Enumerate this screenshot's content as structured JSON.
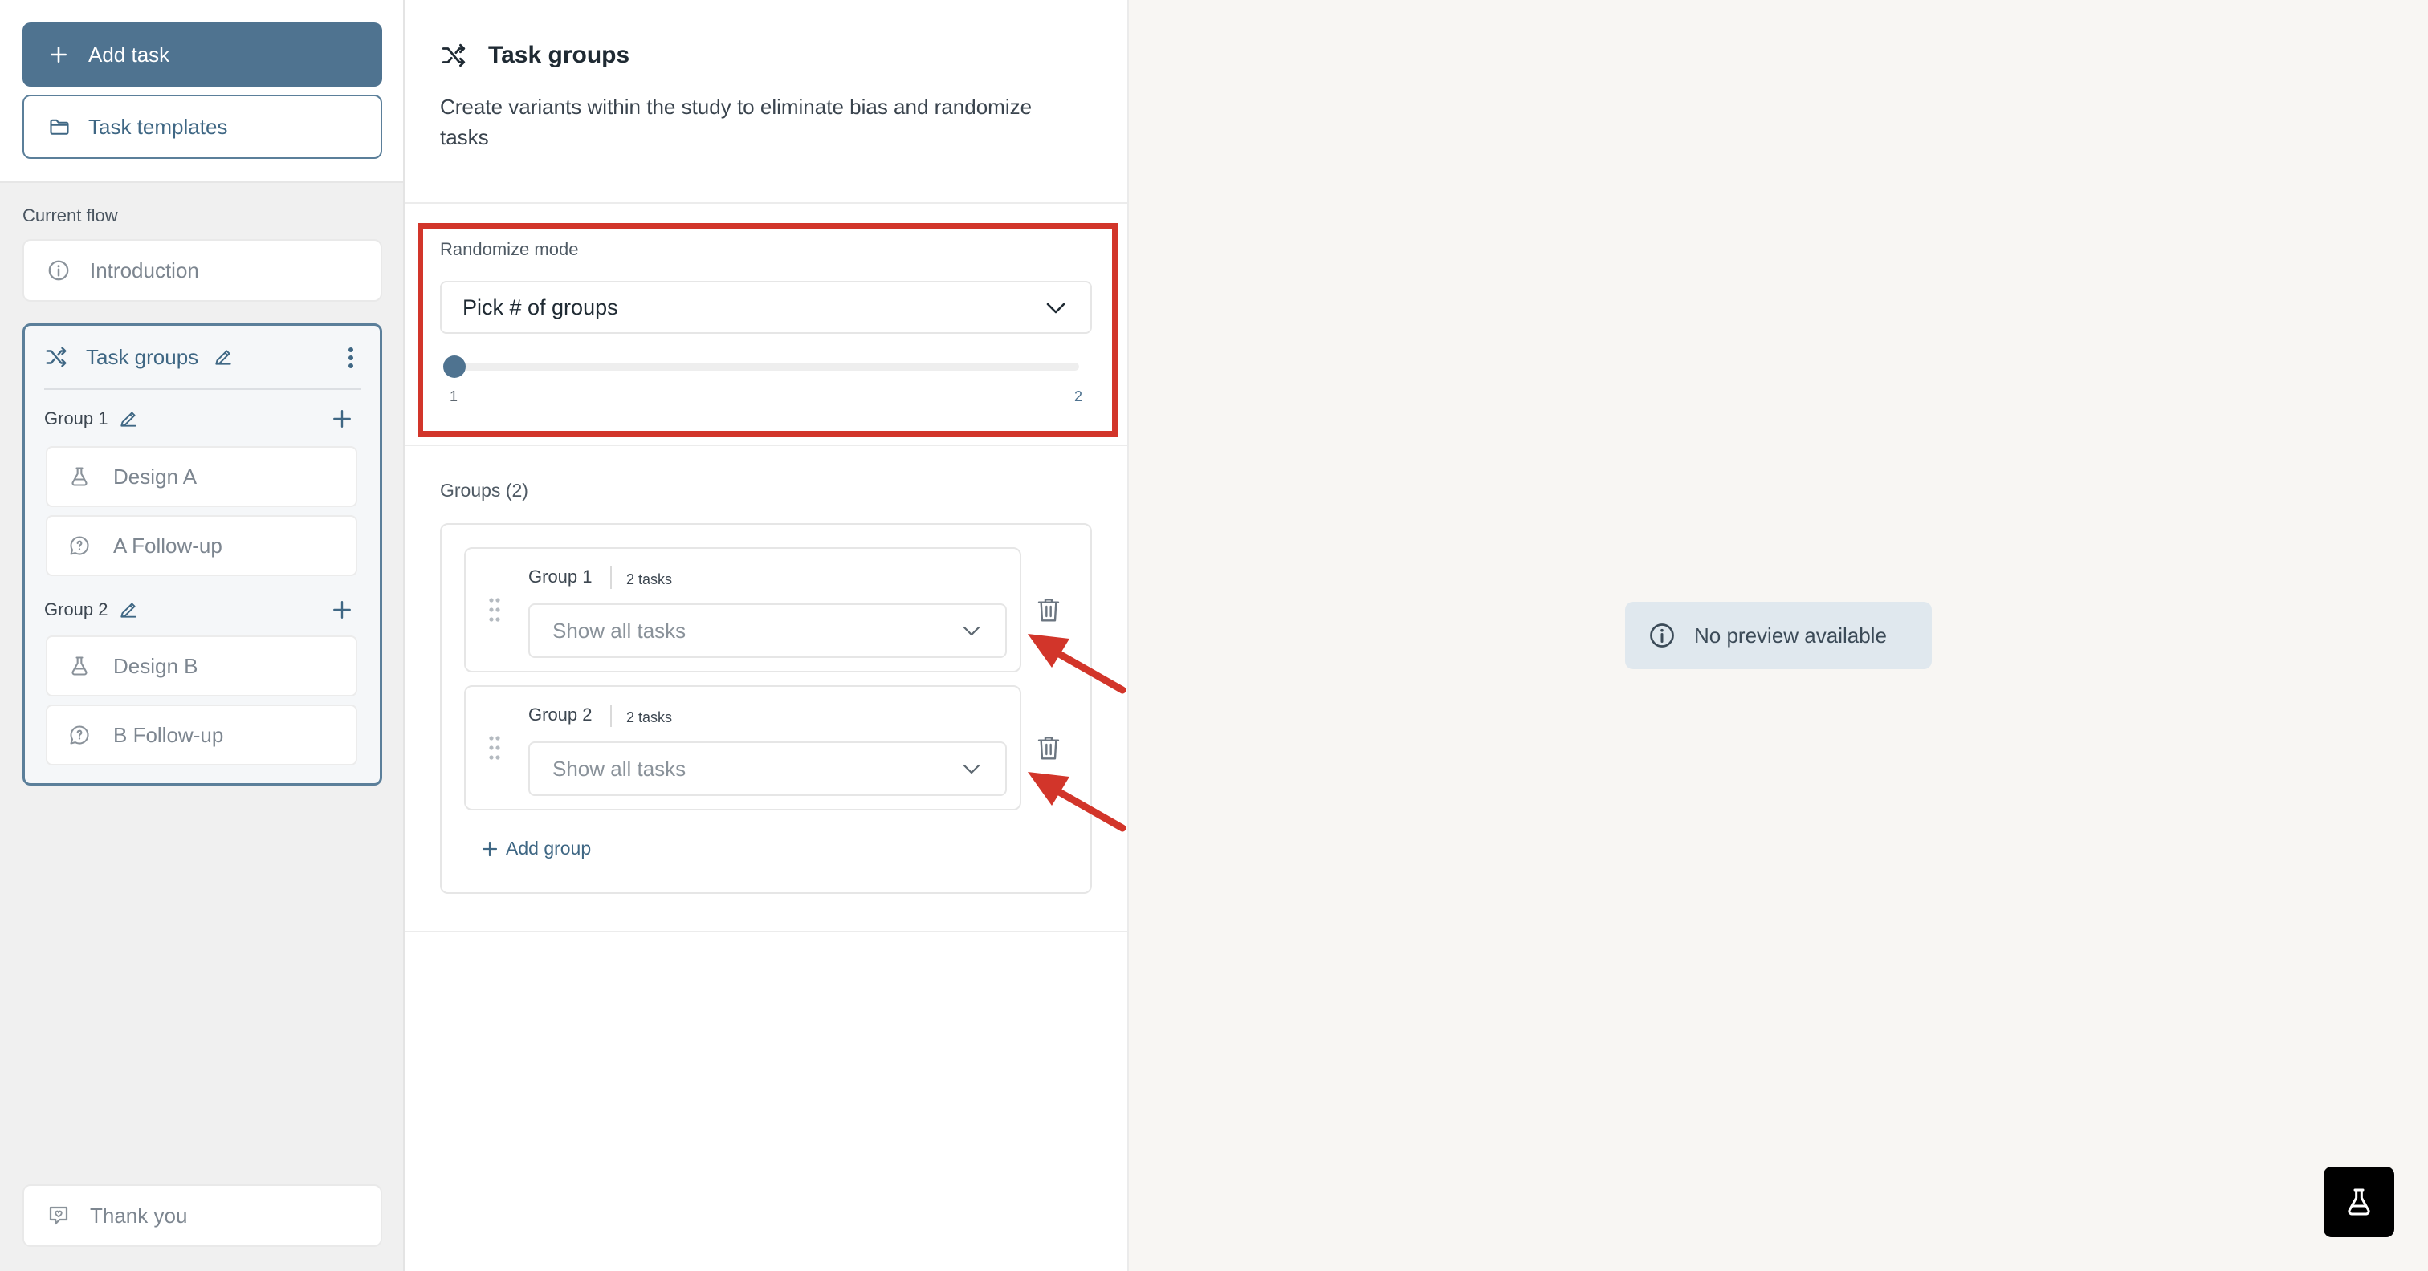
{
  "sidebar": {
    "add_task_label": "Add task",
    "task_templates_label": "Task templates",
    "current_flow_label": "Current flow",
    "introduction_label": "Introduction",
    "task_groups": {
      "title": "Task groups",
      "groups": [
        {
          "name": "Group 1",
          "tasks": [
            {
              "label": "Design A",
              "icon": "flask-icon"
            },
            {
              "label": "A Follow-up",
              "icon": "question-bubble-icon"
            }
          ]
        },
        {
          "name": "Group 2",
          "tasks": [
            {
              "label": "Design B",
              "icon": "flask-icon"
            },
            {
              "label": "B Follow-up",
              "icon": "question-bubble-icon"
            }
          ]
        }
      ]
    },
    "thank_you_label": "Thank you"
  },
  "panel": {
    "title": "Task groups",
    "description": "Create variants within the study to eliminate bias and randomize tasks",
    "randomize_mode_label": "Randomize mode",
    "randomize_mode_value": "Pick # of groups",
    "slider": {
      "min": "1",
      "max": "2",
      "value": 1
    },
    "groups_label": "Groups (2)",
    "groups": [
      {
        "name": "Group 1",
        "count": "2 tasks",
        "select_value": "Show all tasks"
      },
      {
        "name": "Group 2",
        "count": "2 tasks",
        "select_value": "Show all tasks"
      }
    ],
    "add_group_label": "Add group"
  },
  "preview": {
    "message": "No preview available"
  },
  "colors": {
    "accent": "#4f7390",
    "highlight": "#d2352a",
    "background": "#f8f6f3"
  }
}
